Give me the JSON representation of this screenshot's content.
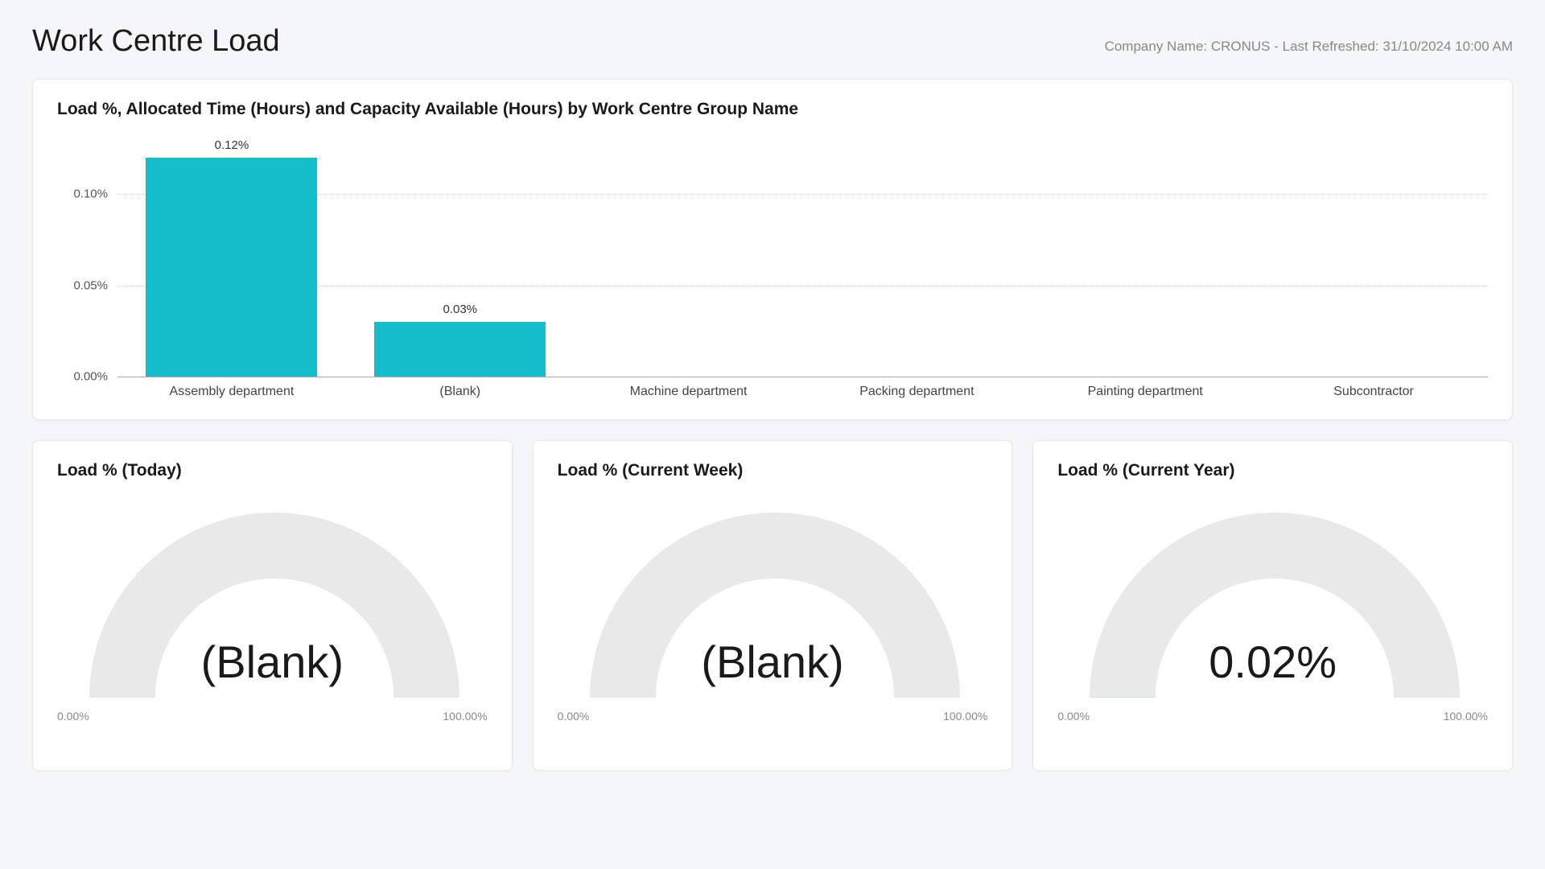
{
  "header": {
    "title": "Work Centre Load",
    "company_line": "Company Name: CRONUS - Last Refreshed: 31/10/2024 10:00 AM"
  },
  "bar_chart": {
    "title": "Load %, Allocated Time (Hours) and Capacity Available (Hours) by Work Centre Group Name",
    "y_ticks": [
      "0.10%",
      "0.05%",
      "0.00%"
    ]
  },
  "gauges": [
    {
      "title": "Load % (Today)",
      "value_label": "(Blank)",
      "min_label": "0.00%",
      "max_label": "100.00%"
    },
    {
      "title": "Load % (Current Week)",
      "value_label": "(Blank)",
      "min_label": "0.00%",
      "max_label": "100.00%"
    },
    {
      "title": "Load % (Current Year)",
      "value_label": "0.02%",
      "min_label": "0.00%",
      "max_label": "100.00%"
    }
  ],
  "chart_data": [
    {
      "type": "bar",
      "title": "Load %, Allocated Time (Hours) and Capacity Available (Hours) by Work Centre Group Name",
      "categories": [
        "Assembly department",
        "(Blank)",
        "Machine department",
        "Packing department",
        "Painting department",
        "Subcontractor"
      ],
      "series": [
        {
          "name": "Load %",
          "values": [
            0.12,
            0.03,
            0,
            0,
            0,
            0
          ],
          "labels": [
            "0.12%",
            "0.03%",
            "",
            "",
            "",
            ""
          ]
        }
      ],
      "ylabel": "Load %",
      "ylim": [
        0,
        0.13
      ],
      "y_ticks": [
        0.0,
        0.05,
        0.1
      ]
    },
    {
      "type": "gauge",
      "title": "Load % (Today)",
      "value": null,
      "min": 0.0,
      "max": 100.0
    },
    {
      "type": "gauge",
      "title": "Load % (Current Week)",
      "value": null,
      "min": 0.0,
      "max": 100.0
    },
    {
      "type": "gauge",
      "title": "Load % (Current Year)",
      "value": 0.02,
      "min": 0.0,
      "max": 100.0
    }
  ]
}
